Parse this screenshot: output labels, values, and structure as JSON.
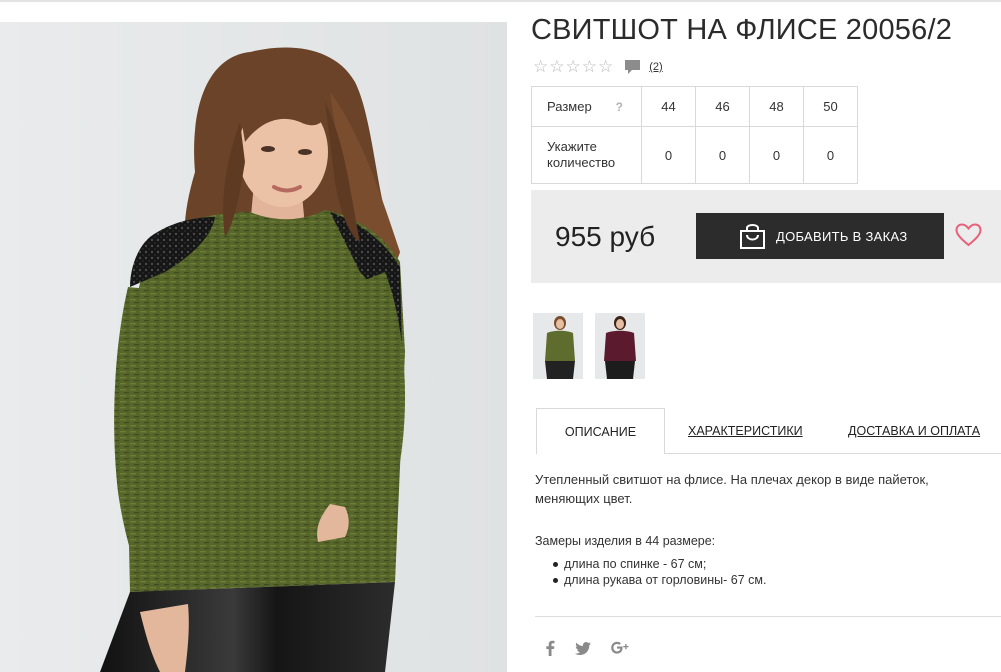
{
  "product": {
    "title": "СВИТШОТ НА ФЛИСЕ 20056/2",
    "rating": {
      "stars": 0,
      "max": 5,
      "reviews_link": "(2)"
    }
  },
  "size_table": {
    "size_label": "Размер",
    "help_icon": "?",
    "sizes": [
      "44",
      "46",
      "48",
      "50"
    ],
    "qty_label": "Укажите количество",
    "quantities": [
      "0",
      "0",
      "0",
      "0"
    ]
  },
  "buy": {
    "price": "955 руб",
    "add_button": "ДОБАВИТЬ В ЗАКАЗ",
    "icons": {
      "bag": "shopping-bag-icon",
      "favorite": "heart-icon"
    },
    "colors": {
      "button": "#2c2c2c",
      "heart": "#e8607a",
      "panel": "#ececec"
    }
  },
  "thumbnails": [
    {
      "alt": "зелёный"
    },
    {
      "alt": "бордовый"
    }
  ],
  "tabs": [
    {
      "label": "ОПИСАНИЕ",
      "active": true
    },
    {
      "label": "ХАРАКТЕРИСТИКИ",
      "active": false
    },
    {
      "label": "ДОСТАВКА И ОПЛАТА",
      "active": false
    }
  ],
  "description": {
    "text": "Утепленный свитшот на флисе. На плечах декор в виде пайеток, меняющих цвет.",
    "measure_title": "Замеры изделия в 44 размере:",
    "measures": [
      "длина по спинке - 67 см;",
      "длина рукава от горловины- 67 см."
    ]
  },
  "social": {
    "icons": [
      "facebook-icon",
      "twitter-icon",
      "google-plus-icon"
    ]
  }
}
